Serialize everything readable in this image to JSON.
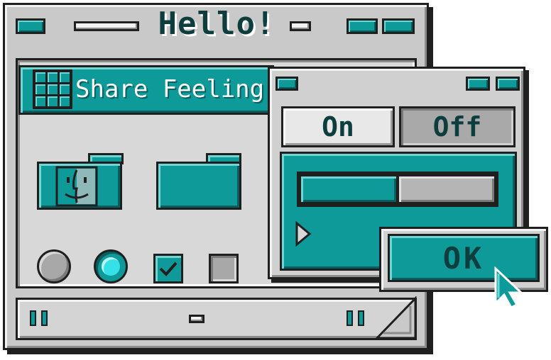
{
  "main_window": {
    "title": "Hello!",
    "header": {
      "label": "Share Feeling"
    },
    "folders": [
      {
        "name": "finder-folder"
      },
      {
        "name": "plain-folder"
      }
    ],
    "controls": {
      "radio_unselected": false,
      "radio_selected": true,
      "checkbox_checked": true,
      "checkbox_unchecked": false
    }
  },
  "dialog": {
    "toggle": {
      "on_label": "On",
      "off_label": "Off",
      "selected": "On"
    },
    "slider": {
      "value_fraction": 0.5
    },
    "ok_label": "OK"
  },
  "colors": {
    "accent": "#0f9a9a",
    "accent_light": "#6fd6d6",
    "accent_dark": "#065e5e",
    "window_gray": "#c9c9c9",
    "outline": "#1f1f1f",
    "text_dark": "#0d3d3d"
  }
}
